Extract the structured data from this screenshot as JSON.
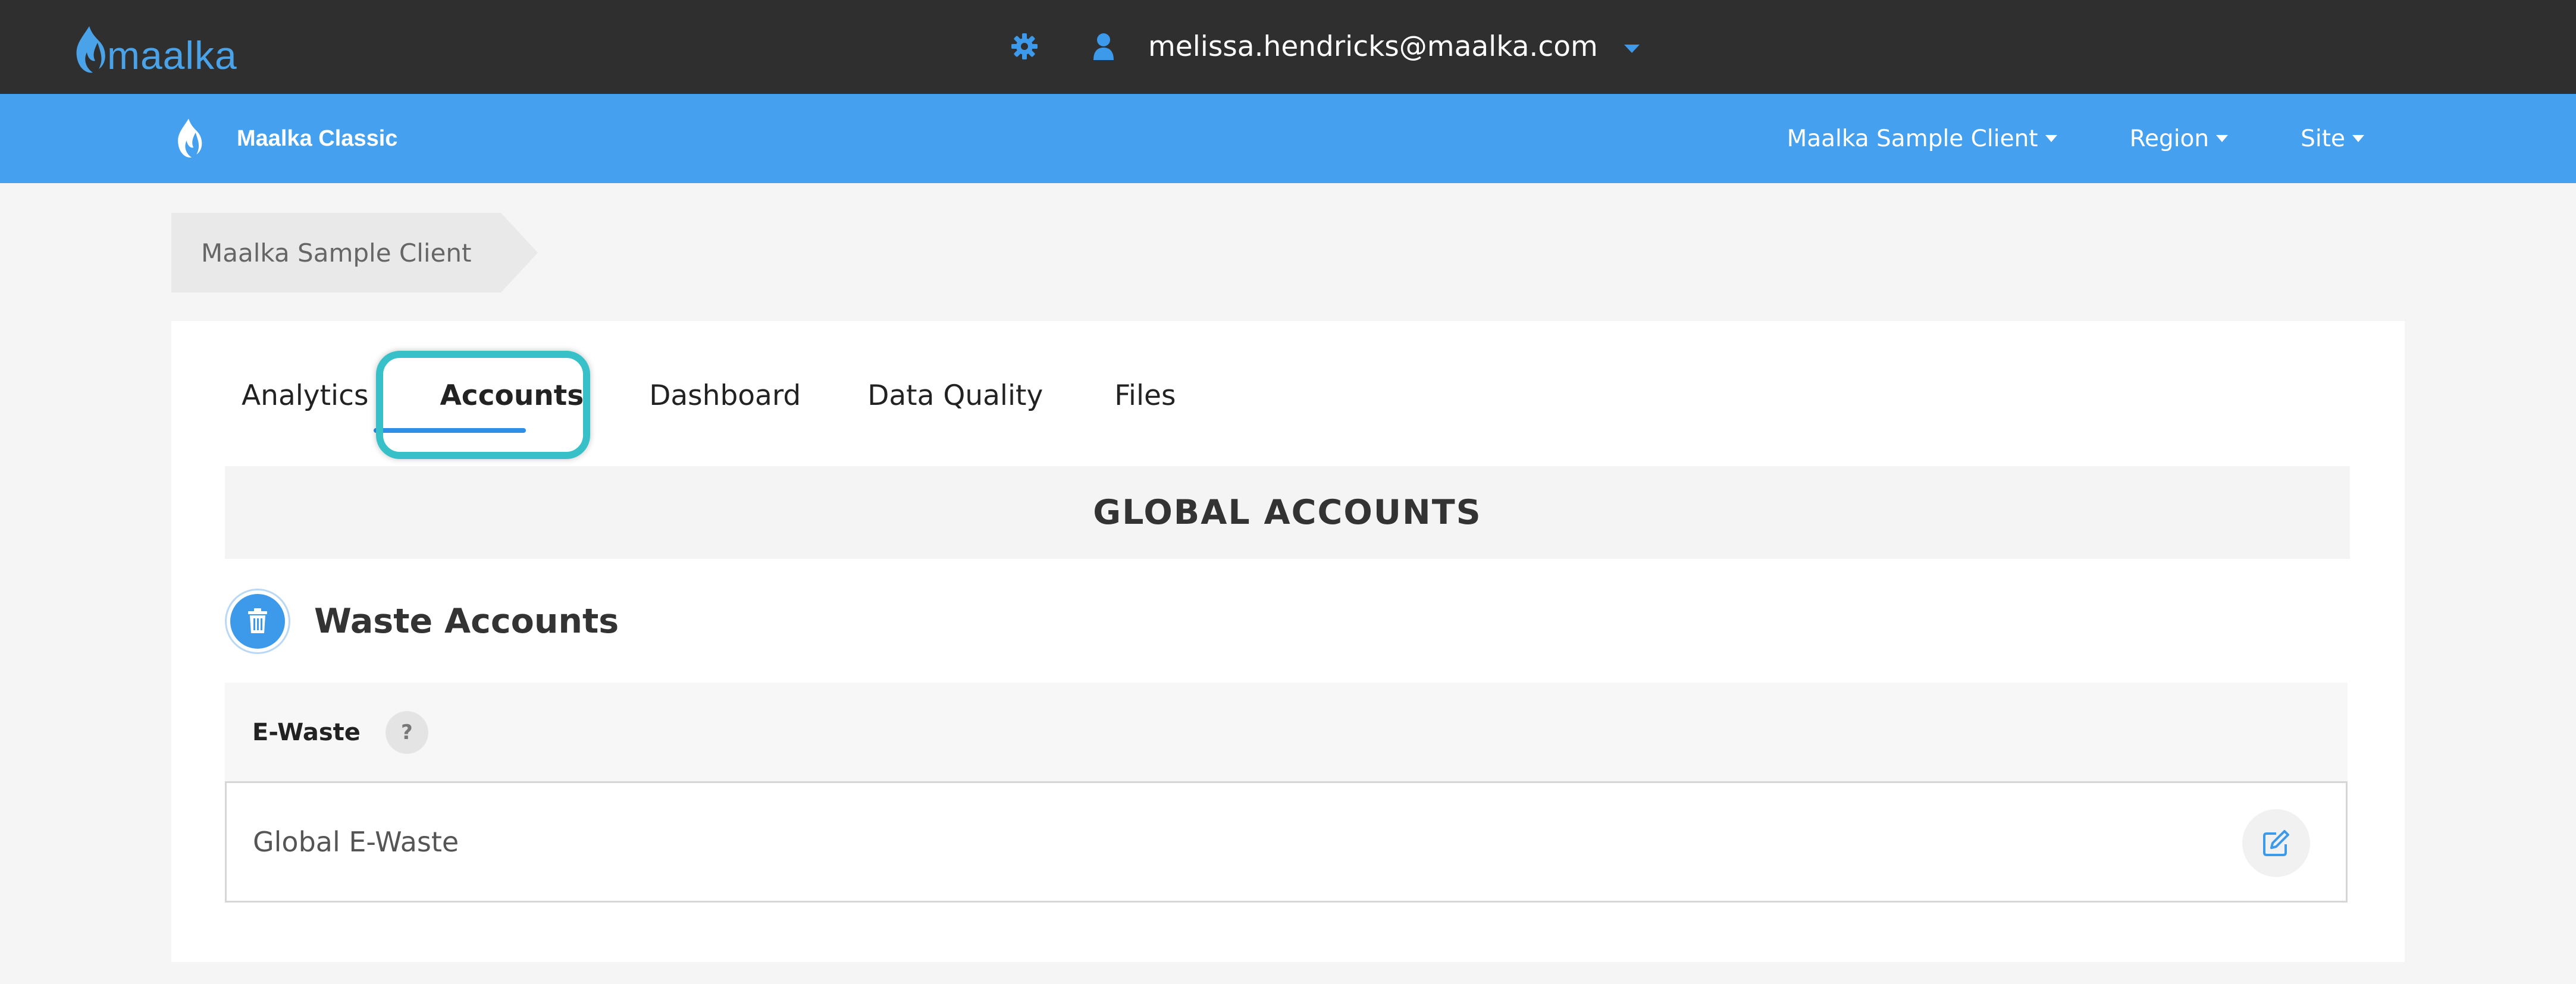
{
  "app": {
    "logo_text": "maalka",
    "user_email": "melissa.hendricks@maalka.com"
  },
  "navbar": {
    "brand": "Maalka Classic",
    "menus": [
      "Maalka Sample Client",
      "Region",
      "Site"
    ]
  },
  "breadcrumb": {
    "item": "Maalka Sample Client"
  },
  "tabs": [
    "Analytics",
    "Accounts",
    "Dashboard",
    "Data Quality",
    "Files"
  ],
  "active_tab": "Accounts",
  "section": {
    "title": "GLOBAL ACCOUNTS"
  },
  "waste": {
    "title": "Waste Accounts",
    "group_label": "E-Waste",
    "help": "?",
    "account_name": "Global E-Waste"
  },
  "colors": {
    "topbar": "#2f2f2f",
    "navbar": "#45a1ef",
    "accent": "#2f8fe6",
    "highlight": "#37c0c8"
  },
  "icons": [
    "flame-logo-icon",
    "gear-icon",
    "user-icon",
    "caret-down-icon",
    "trash-icon",
    "edit-icon"
  ]
}
